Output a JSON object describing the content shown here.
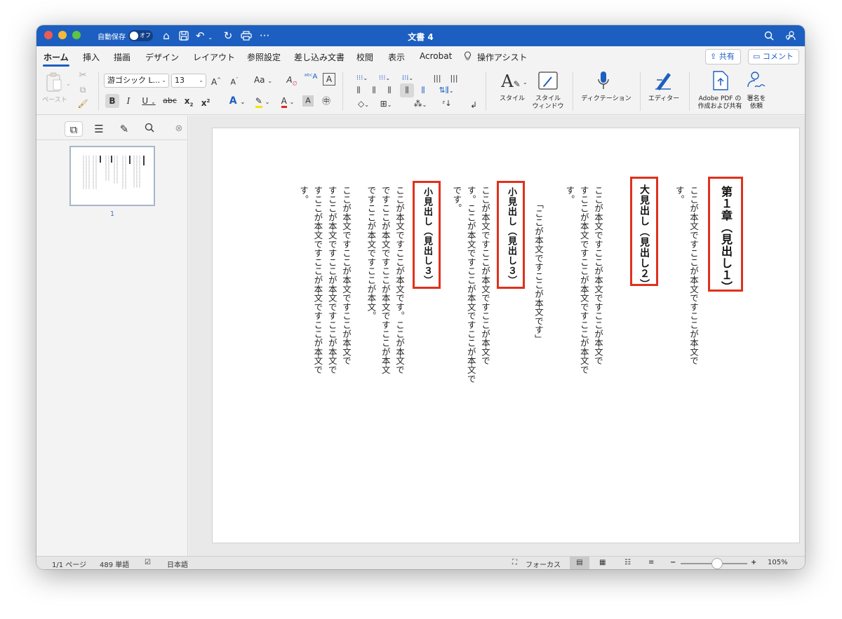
{
  "window": {
    "title": "文書 4",
    "autosave_label": "自動保存",
    "autosave_state": "オフ"
  },
  "menu_tabs": [
    "ホーム",
    "挿入",
    "描画",
    "デザイン",
    "レイアウト",
    "参照設定",
    "差し込み文書",
    "校閲",
    "表示",
    "Acrobat",
    "操作アシスト"
  ],
  "top_buttons": {
    "share": "共有",
    "comment": "コメント"
  },
  "ribbon": {
    "paste_label": "ペースト",
    "font_name": "游ゴシック L...",
    "font_size": "13",
    "style_label": "スタイル",
    "style_window_label_1": "スタイル",
    "style_window_label_2": "ウィンドウ",
    "dictation_label": "ディクテーション",
    "editor_label": "エディター",
    "adobe_label_1": "Adobe PDF の",
    "adobe_label_2": "作成および共有",
    "sign_label_1": "署名を",
    "sign_label_2": "依頼"
  },
  "sidebar": {
    "page_number": "1"
  },
  "document": {
    "col1_heading": "第１章（見出し１）",
    "col2_text": "ここが本文ですここが本文ですここが本文で\nす。",
    "col3_heading": "大見出し（見出し２）",
    "col4_text": "ここが本文ですここが本文ですここが本文で\nすここが本文ですここが本文ですここが本文で\nす。",
    "col5_text": "「ここが本文ですここが本文です」",
    "col6_heading": "小見出し（見出し３）",
    "col7_text": "ここが本文ですここが本文ですここが本文で\nす。ここが本文ですここが本文ですここが本文で\nです。",
    "col8_heading": "小見出し（見出し３）",
    "col9_text": "ここが本文ですここが本文です。ここが本文で\nですここが本文ですここが本文ですここが本文\nですここが本文ですここが本文。",
    "col10_text": "ここが本文ですここが本文ですここが本文で\nすここが本文ですここが本文ですここが本文で\nすここが本文ですここが本文ですここが本文で\nす。"
  },
  "statusbar": {
    "page": "1/1 ページ",
    "words": "489 単語",
    "language": "日本語",
    "focus": "フォーカス",
    "zoom": "105%",
    "zoom_level_fraction": 0.55
  },
  "colors": {
    "accent": "#1d5fc0",
    "annotation_box": "#e0311d"
  }
}
